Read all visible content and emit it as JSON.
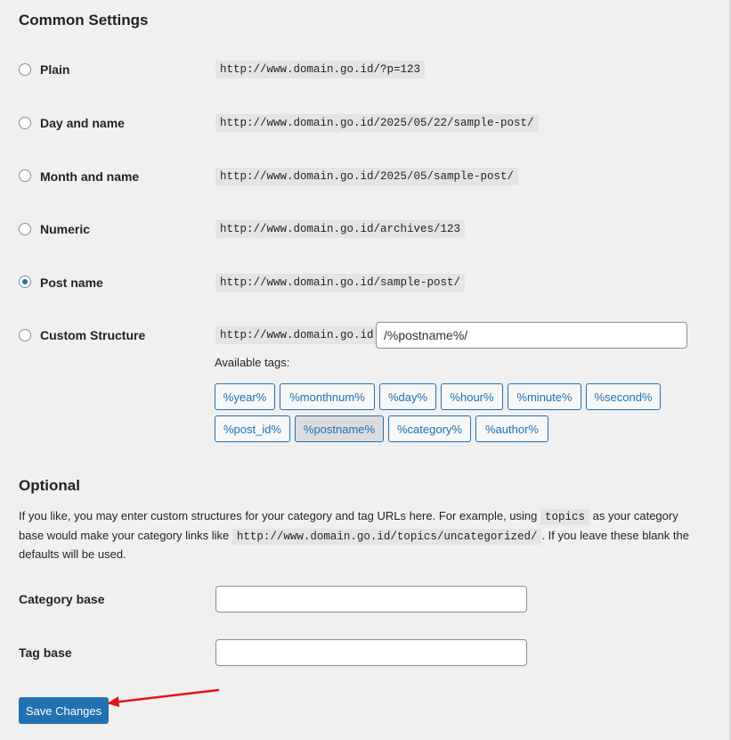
{
  "sections": {
    "common_title": "Common Settings",
    "optional_title": "Optional"
  },
  "permalink_options": [
    {
      "label": "Plain",
      "example": "http://www.domain.go.id/?p=123",
      "checked": false
    },
    {
      "label": "Day and name",
      "example": "http://www.domain.go.id/2025/05/22/sample-post/",
      "checked": false
    },
    {
      "label": "Month and name",
      "example": "http://www.domain.go.id/2025/05/sample-post/",
      "checked": false
    },
    {
      "label": "Numeric",
      "example": "http://www.domain.go.id/archives/123",
      "checked": false
    },
    {
      "label": "Post name",
      "example": "http://www.domain.go.id/sample-post/",
      "checked": true
    },
    {
      "label": "Custom Structure",
      "example": "http://www.domain.go.id",
      "checked": false
    }
  ],
  "custom_structure": {
    "value": "/%postname%/",
    "available_tags_label": "Available tags:",
    "tags": [
      "%year%",
      "%monthnum%",
      "%day%",
      "%hour%",
      "%minute%",
      "%second%",
      "%post_id%",
      "%postname%",
      "%category%",
      "%author%"
    ],
    "active_tag": "%postname%"
  },
  "optional": {
    "desc_part1": "If you like, you may enter custom structures for your category and tag URLs here. For example, using ",
    "desc_code1": "topics",
    "desc_part2": " as your category base would make your category links like ",
    "desc_code2": "http://www.domain.go.id/topics/uncategorized/",
    "desc_part3": ". If you leave these blank the defaults will be used.",
    "category_base_label": "Category base",
    "category_base_value": "",
    "tag_base_label": "Tag base",
    "tag_base_value": ""
  },
  "buttons": {
    "save_label": "Save Changes"
  },
  "colors": {
    "accent": "#2271b1",
    "annotation_arrow": "#e0121b"
  }
}
